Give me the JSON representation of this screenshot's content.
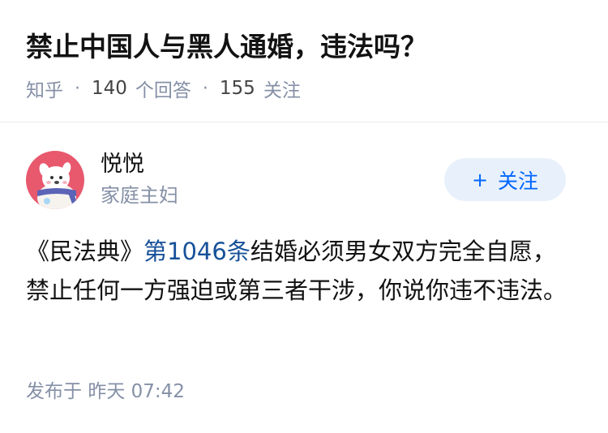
{
  "question": {
    "title": "禁止中国人与黑人通婚，违法吗？",
    "source": "知乎",
    "answer_count": "140",
    "answer_label": "个回答",
    "follower_count": "155",
    "follower_label": "关注",
    "separator": "·"
  },
  "author": {
    "name": "悦悦",
    "bio": "家庭主妇",
    "avatar_icon": "cartoon-dog-avatar-icon",
    "follow_plus": "+",
    "follow_label": "关注"
  },
  "answer": {
    "text_before_link": "《民法典》",
    "link_text": "第1046条",
    "text_after_link": "结婚必须男女双方完全自愿，禁止任何一方强迫或第三者干涉，你说你违不违法。",
    "publish_prefix": "发布于",
    "publish_time": "昨天 07:42"
  },
  "colors": {
    "title": "#121212",
    "meta": "#8590a6",
    "link": "#175199",
    "follow_bg": "#e8f1fb",
    "follow_text": "#0066ff",
    "avatar_bg": "#e8596e"
  }
}
